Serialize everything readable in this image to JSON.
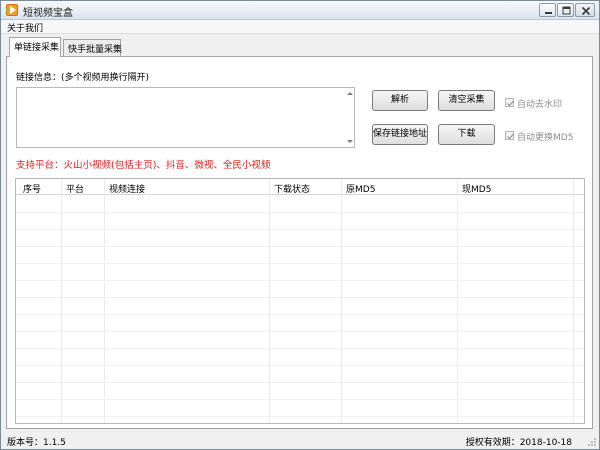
{
  "window": {
    "title": "短视频宝盒"
  },
  "menu": {
    "items": [
      "关于我们"
    ]
  },
  "tabs": [
    {
      "label": "单链接采集",
      "active": true
    },
    {
      "label": "快手批量采集",
      "active": false
    }
  ],
  "form": {
    "link_label": "链接信息：(多个视频用换行隔开)",
    "link_value": "",
    "buttons": {
      "parse": "解析",
      "clear": "清空采集",
      "save": "保存链接地址",
      "download": "下载"
    },
    "checkboxes": [
      {
        "label": "自动去水印",
        "checked": true,
        "disabled": true
      },
      {
        "label": "自动更换MD5",
        "checked": true,
        "disabled": true
      }
    ],
    "support_text": "支持平台：火山小视频(包括主页)、抖音、微视、全民小视频"
  },
  "table": {
    "columns": [
      "序号",
      "平台",
      "视频连接",
      "下载状态",
      "原MD5",
      "现MD5"
    ],
    "rows": []
  },
  "status": {
    "version": "版本号：1.1.5",
    "expiry": "授权有效期：2018-10-18"
  },
  "colors": {
    "support_text": "#e02020",
    "accent": "#f2a11d"
  }
}
